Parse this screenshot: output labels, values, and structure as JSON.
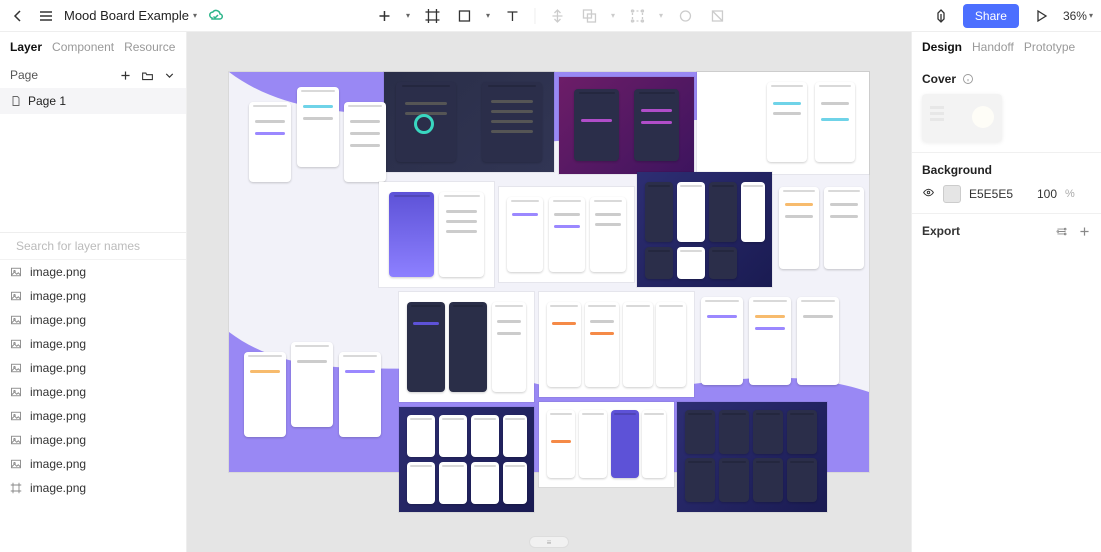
{
  "header": {
    "file_name": "Mood Board Example",
    "zoom": "36%",
    "share_label": "Share"
  },
  "left_sidebar": {
    "tabs": {
      "layer": "Layer",
      "component": "Component",
      "resource": "Resource"
    },
    "pages_label": "Page",
    "page_1": "Page 1",
    "search_placeholder": "Search for layer names",
    "layers": [
      "image.png",
      "image.png",
      "image.png",
      "image.png",
      "image.png",
      "image.png",
      "image.png",
      "image.png",
      "image.png",
      "image.png"
    ]
  },
  "right_panel": {
    "tabs": {
      "design": "Design",
      "handoff": "Handoff",
      "prototype": "Prototype"
    },
    "cover_label": "Cover",
    "background_label": "Background",
    "bg_hex": "E5E5E5",
    "bg_opacity": "100",
    "export_label": "Export"
  },
  "colors": {
    "accent": "#4c6fff",
    "canvas_bg": "#e5e5e5"
  },
  "icons": {
    "back": "back-icon",
    "menu": "menu-icon",
    "cloud": "cloud-synced-icon",
    "plus": "plus-icon",
    "crop": "frame-icon",
    "shape": "shape-icon",
    "text": "text-icon",
    "align": "align-icon",
    "group": "boolean-icon",
    "select": "select-icon",
    "ellipse": "mask-icon",
    "clip": "slice-icon",
    "component_share": "component-icon",
    "play": "play-icon",
    "folder": "folder-icon",
    "page": "page-icon",
    "image": "image-icon",
    "frame": "frame-layer-icon",
    "search": "search-icon",
    "collapse": "collapse-icon",
    "eye": "visibility-icon",
    "info": "info-icon",
    "settings": "settings-icon"
  }
}
